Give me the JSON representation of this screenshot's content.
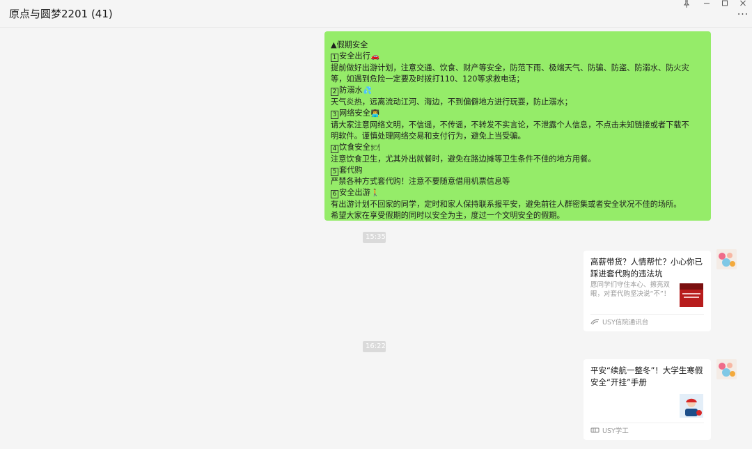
{
  "window": {
    "title": "原点与圆梦2201 (41)",
    "more_label": "···"
  },
  "notice": {
    "lines": [
      {
        "text": "▲假期安全"
      },
      {
        "num": "1",
        "text": "安全出行",
        "emoji": "🚗"
      },
      {
        "text": "提前做好出游计划，注意交通、饮食、财产等安全，防范下雨、极端天气、防骗、防盗、防溺水、防火灾"
      },
      {
        "text": "等，如遇到危险一定要及时拨打110、120等求救电话；"
      },
      {
        "num": "2",
        "text": "防溺水",
        "emoji": "💦"
      },
      {
        "text": "天气炎热，远离流动江河、海边，不到偏僻地方进行玩耍，防止溺水；"
      },
      {
        "num": "3",
        "text": "网络安全",
        "emoji": "👨‍💻"
      },
      {
        "text": "请大家注意网络文明，不信谣，不传谣，不转发不实言论，不泄露个人信息，不点击未知链接或者下载不"
      },
      {
        "text": "明软件。谨慎处理网络交易和支付行为，避免上当受骗。"
      },
      {
        "num": "4",
        "text": "饮食安全",
        "emoji": "🍽"
      },
      {
        "text": "注意饮食卫生，尤其外出就餐时，避免在路边摊等卫生条件不佳的地方用餐。"
      },
      {
        "num": "5",
        "text": "套代购"
      },
      {
        "text": "严禁各种方式套代购！注意不要随意借用机票信息等"
      },
      {
        "num": "6",
        "text": "安全出游",
        "emoji": "🚶"
      },
      {
        "text": "有出游计划不回家的同学，定时和家人保持联系报平安，避免前往人群密集或者安全状况不佳的场所。"
      },
      {
        "text": "希望大家在享受假期的同时以安全为主，度过一个文明安全的假期。"
      }
    ]
  },
  "timestamps": [
    "15:35",
    "16:22"
  ],
  "cards": [
    {
      "title": "高薪带货？人情帮忙？小心你已踩进套代购的违法坑",
      "description": "愿同学们守住本心、擦亮双眼，对套代购坚决说“不”！",
      "source": "USY信院通讯台",
      "source_icon": "source-logo-icon",
      "thumb_color": "#b71c1c"
    },
    {
      "title": "平安“续航一整冬”！大学生寒假安全“开挂”手册",
      "description": "",
      "source": "USY学工",
      "source_icon": "source-logo-icon",
      "thumb_color": "#e3eef8"
    }
  ],
  "colors": {
    "bubble_green": "#95ec69",
    "background": "#f5f5f5",
    "timestamp_bg": "#dadada"
  }
}
